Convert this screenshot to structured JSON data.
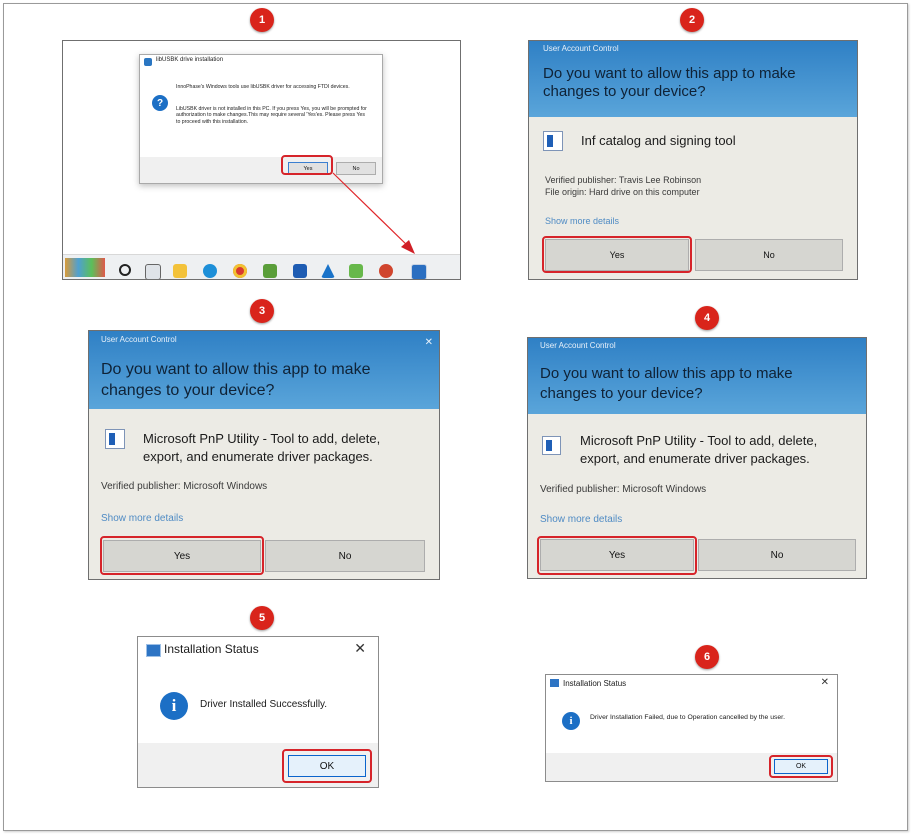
{
  "steps": [
    "1",
    "2",
    "3",
    "4",
    "5",
    "6"
  ],
  "panel1": {
    "dialog_title": "libUSBK drive installation",
    "message_1": "InnoPhase's Windows tools use libUSBK driver for accessing FTDI devices.",
    "message_2": "LibUSBK driver is not installed in this PC. If you press Yes, you will be prompted for authorization to make changes.This may require several 'Yes'es. Please press Yes to proceed with this installation.",
    "yes_label": "Yes",
    "no_label": "No"
  },
  "panel2": {
    "header": "User Account Control",
    "question": "Do you want to allow this app to make changes to your device?",
    "app_name": "Inf catalog and signing tool",
    "publisher": "Verified publisher: Travis Lee Robinson",
    "origin": "File origin: Hard drive on this computer",
    "show_more": "Show more details",
    "yes_label": "Yes",
    "no_label": "No"
  },
  "panel3": {
    "header": "User Account Control",
    "question": "Do you want to allow this app to make changes to your device?",
    "app_name": "Microsoft PnP Utility - Tool to add, delete, export, and enumerate driver packages.",
    "publisher": "Verified publisher: Microsoft Windows",
    "show_more": "Show more details",
    "yes_label": "Yes",
    "no_label": "No"
  },
  "panel4": {
    "header": "User Account Control",
    "question": "Do you want to allow this app to make changes to your device?",
    "app_name": "Microsoft PnP Utility - Tool to add, delete, export, and enumerate driver packages.",
    "publisher": "Verified publisher: Microsoft Windows",
    "show_more": "Show more details",
    "yes_label": "Yes",
    "no_label": "No"
  },
  "panel5": {
    "title": "Installation Status",
    "message": "Driver Installed Successfully.",
    "ok_label": "OK"
  },
  "panel6": {
    "title": "Installation Status",
    "message": "Driver Installation Failed, due to Operation cancelled by the user.",
    "ok_label": "OK"
  },
  "colors": {
    "highlight": "#d6242a",
    "badge": "#d9241b",
    "uac_blue": "#3a8ccc",
    "link": "#4f8bc4"
  }
}
